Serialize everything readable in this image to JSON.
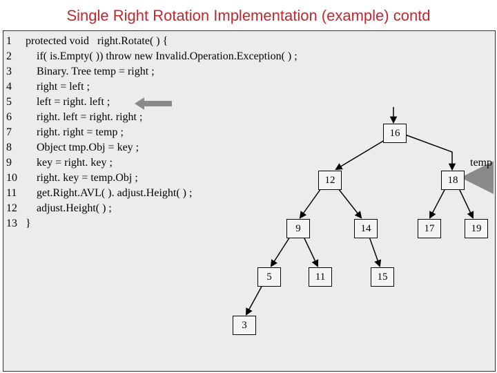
{
  "title": "Single Right Rotation Implementation (example) contd",
  "code": {
    "lines": [
      {
        "n": "1",
        "text": "protected void   right.Rotate( ) {"
      },
      {
        "n": "2",
        "text": "    if( is.Empty( )) throw new Invalid.Operation.Exception( ) ;"
      },
      {
        "n": "3",
        "text": "    Binary. Tree temp = right ;"
      },
      {
        "n": "4",
        "text": "    right = left ;"
      },
      {
        "n": "5",
        "text": "    left = right. left ;"
      },
      {
        "n": "6",
        "text": "    right. left = right. right ;"
      },
      {
        "n": "7",
        "text": "    right. right = temp ;"
      },
      {
        "n": "8",
        "text": "    Object tmp.Obj = key ;"
      },
      {
        "n": "9",
        "text": "    key = right. key ;"
      },
      {
        "n": "10",
        "text": "    right. key = temp.Obj ;"
      },
      {
        "n": "11",
        "text": "    get.Right.AVL( ). adjust.Height( ) ;"
      },
      {
        "n": "12",
        "text": "    adjust.Height( ) ;"
      },
      {
        "n": "13",
        "text": "}"
      }
    ]
  },
  "tree": {
    "temp_label": "temp",
    "nodes": {
      "n16": "16",
      "n12": "12",
      "n18": "18",
      "n9": "9",
      "n14": "14",
      "n17": "17",
      "n19": "19",
      "n5": "5",
      "n11": "11",
      "n15": "15",
      "n3": "3"
    }
  },
  "chart_data": {
    "type": "tree",
    "title": "AVL tree state during right rotation",
    "nodes": [
      16,
      12,
      18,
      9,
      14,
      17,
      19,
      5,
      11,
      15,
      3
    ],
    "edges": [
      [
        16,
        12
      ],
      [
        16,
        18
      ],
      [
        12,
        9
      ],
      [
        12,
        14
      ],
      [
        18,
        17
      ],
      [
        18,
        19
      ],
      [
        9,
        5
      ],
      [
        9,
        11
      ],
      [
        14,
        15
      ],
      [
        5,
        3
      ]
    ],
    "annotations": {
      "temp_points_to": 18,
      "highlighted_code_line": 5,
      "incoming_arrow_to_root": 16
    }
  }
}
